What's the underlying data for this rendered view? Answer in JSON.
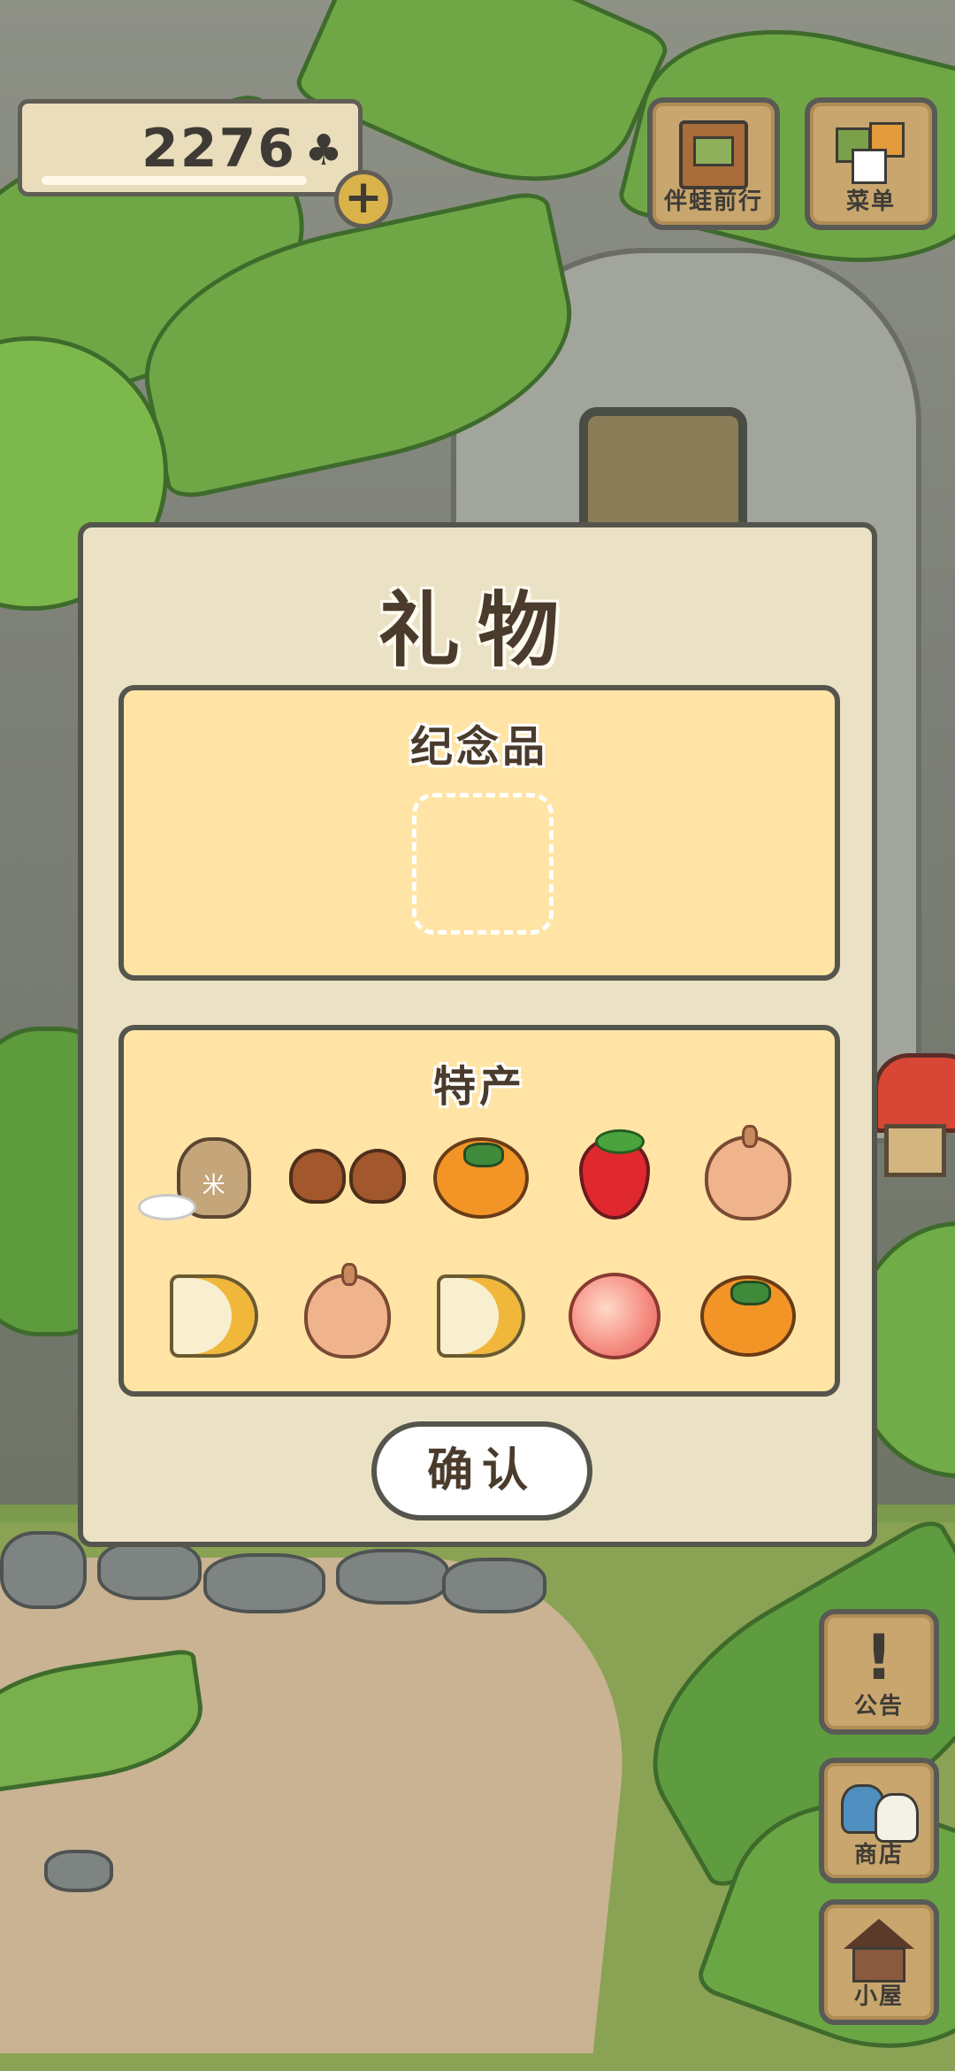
{
  "hud": {
    "clover_count": "2276",
    "clover_icon": "♣",
    "add_icon": "+",
    "travel_label": "伴蛙前行",
    "menu_label": "菜单"
  },
  "side_buttons": {
    "notice_label": "公告",
    "notice_icon": "!",
    "shop_label": "商店",
    "house_label": "小屋"
  },
  "dialog": {
    "title": "礼物",
    "souvenir_title": "纪念品",
    "specialty_title": "特产",
    "confirm_label": "确认",
    "specialty_items": [
      "rice-bag-icon",
      "chestnuts-icon",
      "persimmon-icon",
      "strawberry-icon",
      "onion-icon",
      "cheese-icon",
      "onion-icon",
      "cheese-icon",
      "peach-icon",
      "persimmon-icon"
    ]
  },
  "colors": {
    "panel": "#ffe4a6",
    "dialog_bg": "#ebe2c5",
    "border": "#54554c",
    "wood": "#c8a66e"
  }
}
